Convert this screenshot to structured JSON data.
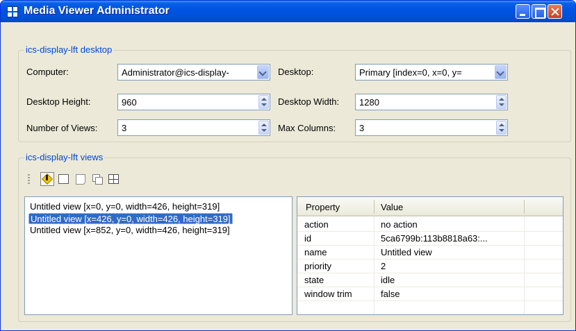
{
  "window": {
    "title": "Media Viewer Administrator"
  },
  "desktop_group": {
    "legend": "ics-display-lft desktop",
    "computer_label": "Computer:",
    "computer_value": "Administrator@ics-display-",
    "desktop_label": "Desktop:",
    "desktop_value": "Primary [index=0, x=0, y=",
    "height_label": "Desktop Height:",
    "height_value": "960",
    "width_label": "Desktop Width:",
    "width_value": "1280",
    "views_label": "Number of Views:",
    "views_value": "3",
    "columns_label": "Max Columns:",
    "columns_value": "3"
  },
  "views_group": {
    "legend": "ics-display-lft views",
    "toolbar_icons": [
      "warning-icon",
      "square-icon",
      "page-icon",
      "stacked-windows-icon",
      "grid-icon"
    ],
    "views": [
      "Untitled view [x=0, y=0, width=426, height=319]",
      "Untitled view [x=426, y=0, width=426, height=319]",
      "Untitled view [x=852, y=0, width=426, height=319]"
    ],
    "selected_index": 1
  },
  "properties": {
    "headers": [
      "Property",
      "Value"
    ],
    "rows": [
      [
        "action",
        "no action"
      ],
      [
        "id",
        "5ca6799b:113b8818a63:..."
      ],
      [
        "name",
        "Untitled view"
      ],
      [
        "priority",
        "2"
      ],
      [
        "state",
        "idle"
      ],
      [
        "window trim",
        "false"
      ]
    ]
  },
  "colors": {
    "titlebar": "#0054e3",
    "legend": "#0046d5",
    "selection": "#316ac5",
    "window_bg": "#ece9d8"
  }
}
